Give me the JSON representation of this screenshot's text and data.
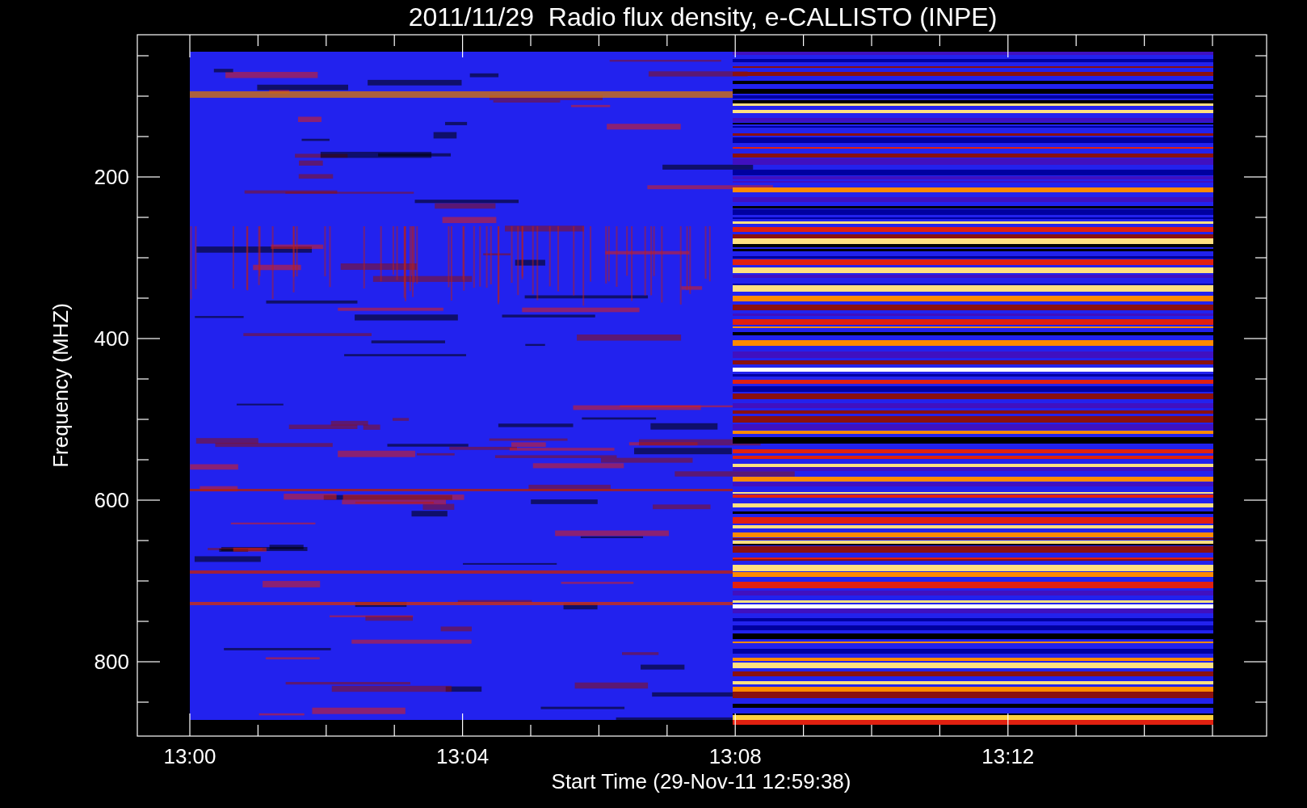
{
  "title": "2011/11/29  Radio flux density, e-CALLISTO (INPE)",
  "y_axis": {
    "label": "Frequency (MHZ)",
    "ticks": [
      "200",
      "400",
      "600",
      "800"
    ]
  },
  "x_axis": {
    "label": "Start Time (29-Nov-11 12:59:38)",
    "ticks": [
      "13:00",
      "13:04",
      "13:08",
      "13:12"
    ]
  }
}
